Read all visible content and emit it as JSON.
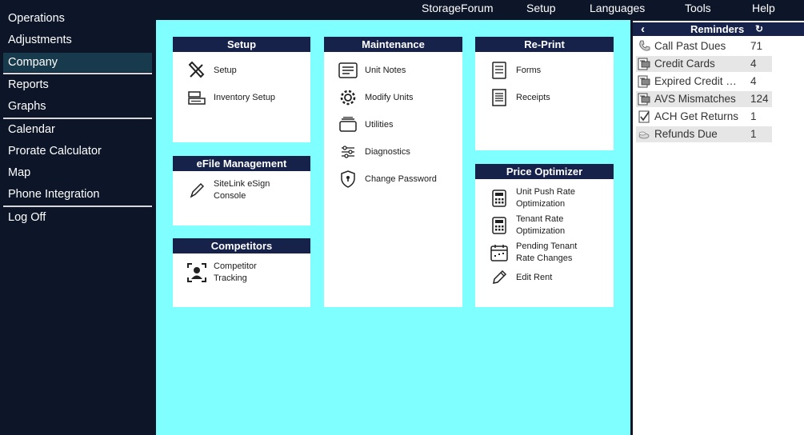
{
  "topnav": [
    "StorageForum",
    "Setup",
    "Languages",
    "Tools",
    "Help"
  ],
  "sidebar": {
    "items": [
      "Operations",
      "Adjustments",
      "Company",
      "Reports",
      "Graphs",
      "Calendar",
      "Prorate Calculator",
      "Map",
      "Phone Integration",
      "Log Off"
    ],
    "active": "Company"
  },
  "panels": {
    "setup": {
      "title": "Setup",
      "items": [
        "Setup",
        "Inventory Setup"
      ]
    },
    "efile": {
      "title": "eFile Management",
      "items": [
        "SiteLink eSign\nConsole"
      ]
    },
    "competitors": {
      "title": "Competitors",
      "items": [
        "Competitor\nTracking"
      ]
    },
    "maintenance": {
      "title": "Maintenance",
      "items": [
        "Unit Notes",
        "Modify Units",
        "Utilities",
        "Diagnostics",
        "Change Password"
      ]
    },
    "reprint": {
      "title": "Re-Print",
      "items": [
        "Forms",
        "Receipts"
      ]
    },
    "price": {
      "title": "Price Optimizer",
      "items": [
        "Unit Push Rate\nOptimization",
        "Tenant Rate\nOptimization",
        "Pending Tenant\nRate Changes",
        "Edit Rent"
      ]
    }
  },
  "reminders": {
    "title": "Reminders",
    "rows": [
      {
        "label": "Call Past Dues",
        "count": "71",
        "icon": "phone-icon"
      },
      {
        "label": "Credit Cards",
        "count": "4",
        "icon": "card-icon"
      },
      {
        "label": "Expired Credit Cards",
        "count": "4",
        "icon": "card-icon"
      },
      {
        "label": "AVS Mismatches",
        "count": "124",
        "icon": "card-icon"
      },
      {
        "label": "ACH Get Returns",
        "count": "1",
        "icon": "checklist-icon"
      },
      {
        "label": "Refunds Due",
        "count": "1",
        "icon": "money-icon"
      }
    ]
  },
  "colors": {
    "background": "#0d1628",
    "header": "#16224a",
    "workspace": "#7fffff",
    "active_item": "#173a4c"
  }
}
